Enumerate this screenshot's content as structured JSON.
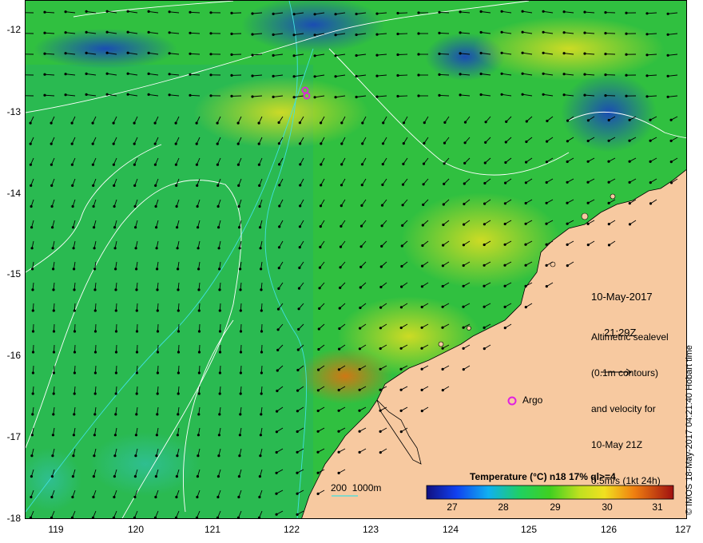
{
  "map": {
    "lat_labels": [
      "-12",
      "-13",
      "-14",
      "-15",
      "-16",
      "-17",
      "-18"
    ],
    "lon_labels": [
      "119",
      "120",
      "121",
      "122",
      "123",
      "124",
      "125",
      "126",
      "127"
    ],
    "lat_range": [
      -18,
      -11.7
    ],
    "lon_range": [
      118.7,
      127
    ],
    "date": "10-May-2017",
    "time": "21:29Z",
    "altimetry_lines": [
      "Altimetric sealevel",
      "(0.1m contours)",
      "and velocity for",
      "10-May 21Z",
      "0.5m/s (1kt 24h)"
    ],
    "argo_label": "Argo",
    "depth_legend": "200  1000m",
    "colorbar_title": "Temperature (°C) n18 17% ql>=4",
    "colorbar_ticks": [
      "27",
      "28",
      "29",
      "30",
      "31"
    ],
    "colorbar_range": [
      26.7,
      31.3
    ],
    "credit": "© IMOS 18-May-2017 04:21:40 Hobart time"
  },
  "colors": {
    "land": "#f7c9a0",
    "cold": "#2040c0",
    "mid": "#30c030",
    "warm": "#e8e020",
    "hot": "#e06010",
    "argo_marker": "#e020e0",
    "depth_contour": "#40e0e0",
    "sealevel_contour": "#ffffff"
  }
}
